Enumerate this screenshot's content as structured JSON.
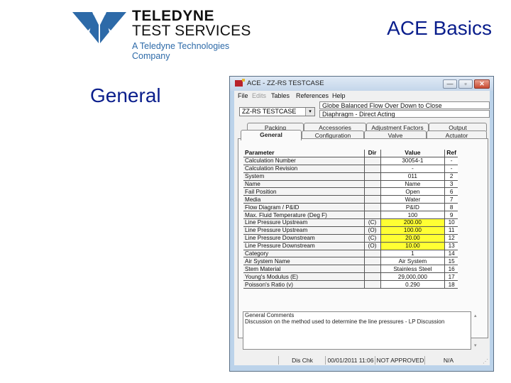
{
  "slide": {
    "logo": {
      "line1": "TELEDYNE",
      "line2": "TEST SERVICES",
      "line3": "A Teledyne Technologies Company",
      "brand_color": "#2d6aa8"
    },
    "title": "ACE Basics",
    "subtitle": "General",
    "title_color": "#0a1e8c"
  },
  "window": {
    "title": "ACE - ZZ-RS TESTCASE",
    "controls": {
      "minimize": "—",
      "maximize": "▫",
      "close": "✕"
    },
    "menu": [
      {
        "label": "File",
        "enabled": true
      },
      {
        "label": "Edits",
        "enabled": false
      },
      {
        "label": "Tables",
        "enabled": true
      },
      {
        "label": "References",
        "enabled": true
      },
      {
        "label": "Help",
        "enabled": true
      }
    ],
    "case_select": {
      "value": "ZZ-RS TESTCASE",
      "arrow": "▾"
    },
    "info_line1": "Globe   Balanced   Flow Over   Down to Close",
    "info_line2": "Diaphragm - Direct Acting",
    "tabs_row1": [
      "Packing",
      "Accessories",
      "Adjustment Factors",
      "Output"
    ],
    "tabs_row2": [
      "General",
      "Configuration",
      "Valve",
      "Actuator"
    ],
    "active_tab": "General",
    "grid": {
      "headers": {
        "parameter": "Parameter",
        "dir": "Dir",
        "value": "Value",
        "ref": "Ref"
      },
      "highlight_color": "#ffff33",
      "rows": [
        {
          "parameter": "Calculation Number",
          "dir": "",
          "value": "30054-1",
          "ref": "-",
          "highlight": false
        },
        {
          "parameter": "Calculation Revision",
          "dir": "",
          "value": "-",
          "ref": "-",
          "highlight": false
        },
        {
          "parameter": "System",
          "dir": "",
          "value": "011",
          "ref": "2",
          "highlight": false
        },
        {
          "parameter": "Name",
          "dir": "",
          "value": "Name",
          "ref": "3",
          "highlight": false
        },
        {
          "parameter": "Fail Position",
          "dir": "",
          "value": "Open",
          "ref": "6",
          "highlight": false
        },
        {
          "parameter": "Media",
          "dir": "",
          "value": "Water",
          "ref": "7",
          "highlight": false
        },
        {
          "parameter": "Flow Diagram / P&ID",
          "dir": "",
          "value": "P&ID",
          "ref": "8",
          "highlight": false
        },
        {
          "parameter": "Max. Fluid Temperature (Deg F)",
          "dir": "",
          "value": "100",
          "ref": "9",
          "highlight": false
        },
        {
          "parameter": "Line Pressure Upstream",
          "dir": "(C)",
          "value": "200.00",
          "ref": "10",
          "highlight": true
        },
        {
          "parameter": "Line Pressure Upstream",
          "dir": "(O)",
          "value": "100.00",
          "ref": "11",
          "highlight": true
        },
        {
          "parameter": "Line Pressure Downstream",
          "dir": "(C)",
          "value": "20.00",
          "ref": "12",
          "highlight": true
        },
        {
          "parameter": "Line Pressure Downstream",
          "dir": "(O)",
          "value": "10.00",
          "ref": "13",
          "highlight": true
        },
        {
          "parameter": "Category",
          "dir": "",
          "value": "1",
          "ref": "14",
          "highlight": false
        },
        {
          "parameter": "Air System Name",
          "dir": "",
          "value": "Air System",
          "ref": "15",
          "highlight": false
        },
        {
          "parameter": "Stem Material",
          "dir": "",
          "value": "Stainless Steel",
          "ref": "16",
          "highlight": false
        },
        {
          "parameter": "Young's Modulus (E)",
          "dir": "",
          "value": "29,000,000",
          "ref": "17",
          "highlight": false
        },
        {
          "parameter": "Poisson's Ratio (v)",
          "dir": "",
          "value": "0.290",
          "ref": "18",
          "highlight": false
        }
      ]
    },
    "comments": {
      "line1": "General Comments",
      "line2": "Discussion on the method used to determine the line pressures - LP Discussion"
    },
    "status_bar": [
      "",
      "Dis Chk",
      "00/01/2011 11:06",
      "NOT APPROVED",
      "N/A"
    ]
  }
}
